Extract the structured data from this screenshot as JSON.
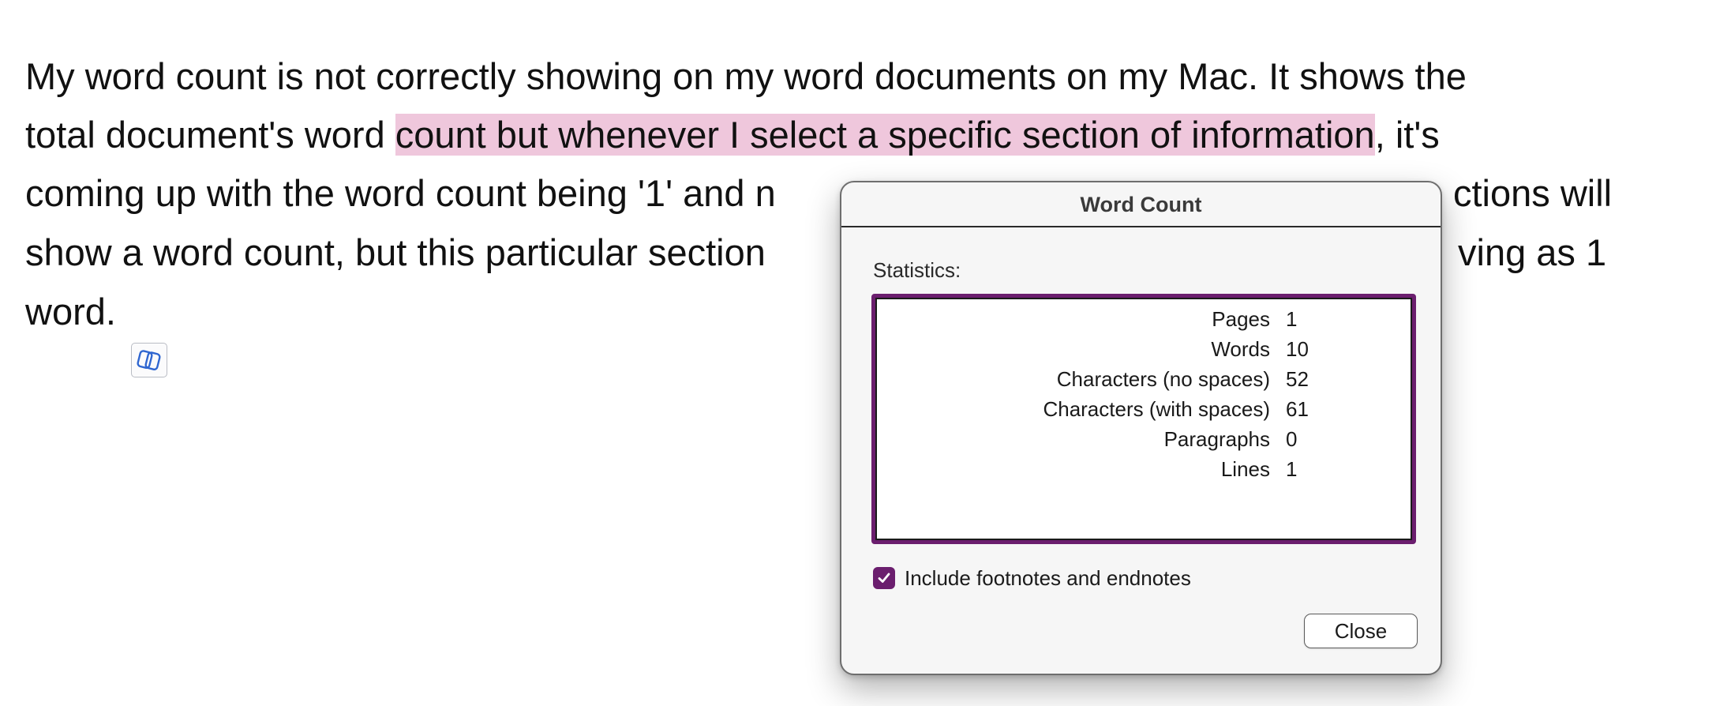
{
  "document": {
    "lines": [
      {
        "text": "My word count is not correctly showing on my word documents on my Mac. It shows the"
      },
      {
        "before": "total document's word ",
        "highlight": "count but whenever I select a specific section of information",
        "after": ", it's"
      },
      {
        "left": "coming up with the word count being '1' and n",
        "right": "ctions will"
      },
      {
        "left": "show a word count, but this particular section",
        "right": "ving as 1"
      },
      {
        "text": "word."
      }
    ],
    "highlight_color": "#efc7dc",
    "badge_icon": "copilot-icon"
  },
  "dialog": {
    "title": "Word Count",
    "statistics_label": "Statistics:",
    "stats": [
      {
        "name": "Pages",
        "value": "1"
      },
      {
        "name": "Words",
        "value": "10"
      },
      {
        "name": "Characters (no spaces)",
        "value": "52"
      },
      {
        "name": "Characters (with spaces)",
        "value": "61"
      },
      {
        "name": "Paragraphs",
        "value": "0"
      },
      {
        "name": "Lines",
        "value": "1"
      }
    ],
    "include_footnotes": {
      "label": "Include footnotes and endnotes",
      "checked": true
    },
    "close_label": "Close",
    "accent_color": "#6b1e6e"
  }
}
